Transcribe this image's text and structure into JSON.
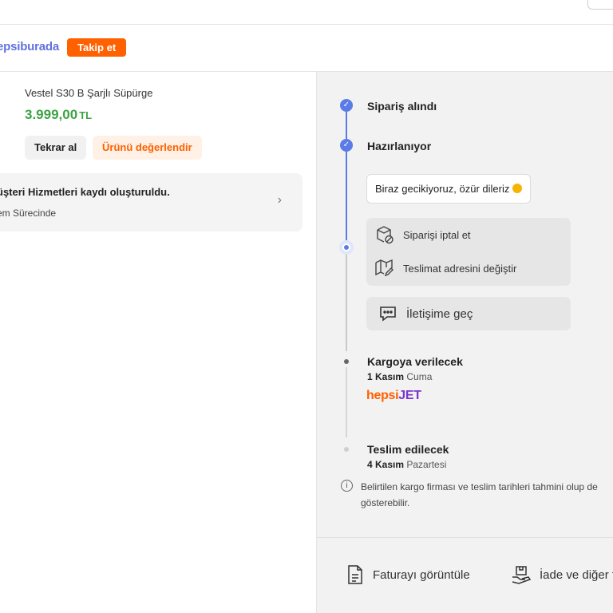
{
  "seller": {
    "name": "epsiburada",
    "follow_label": "Takip et"
  },
  "product": {
    "name": "Vestel S30 B Şarjlı Süpürge",
    "price": "3.999,00",
    "currency": "TL",
    "reorder_label": "Tekrar al",
    "rate_label": "Ürünü değerlendir"
  },
  "support_card": {
    "title": "üşteri Hizmetleri kaydı oluşturuldu.",
    "subtitle": "em Sürecinde"
  },
  "timeline": {
    "steps": [
      {
        "title": "Sipariş alındı",
        "state": "done"
      },
      {
        "title": "Hazırlanıyor",
        "state": "done"
      },
      {
        "title": "Kargoya verilecek",
        "date_bold": "1 Kasım",
        "date_rest": "Cuma",
        "state": "pending"
      },
      {
        "title": "Teslim edilecek",
        "date_bold": "4 Kasım",
        "date_rest": "Pazartesi",
        "state": "future"
      }
    ],
    "delay_message": "Biraz gecikiyoruz, özür dileriz",
    "actions": {
      "cancel_label": "Siparişi iptal et",
      "change_address_label": "Teslimat adresini değiştir"
    },
    "contact_label": "İletişime geç",
    "carrier": {
      "logo_part1": "hepsi",
      "logo_part2": "JET"
    }
  },
  "info_note": {
    "line1": "Belirtilen kargo firması ve teslim tarihleri tahmini olup de",
    "line2": "gösterebilir."
  },
  "footer": {
    "invoice_label": "Faturayı görüntüle",
    "return_label": "İade ve diğer t"
  },
  "colors": {
    "brand_orange": "#ff6000",
    "timeline_blue": "#5b7be6",
    "price_green": "#3ea244",
    "seller_blue": "#6171e0",
    "jet_purple": "#7a35c9"
  }
}
